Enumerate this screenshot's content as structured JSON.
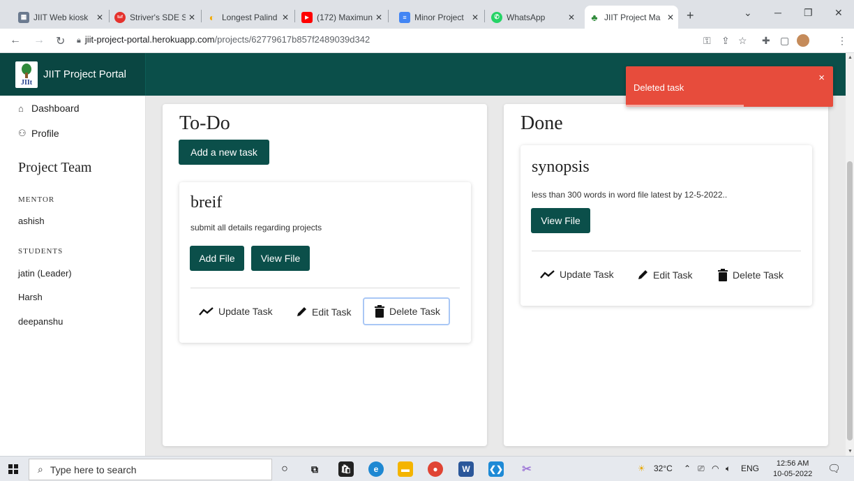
{
  "browser": {
    "tabs": [
      {
        "label": "JIIT Web kiosk",
        "color": "#6b7a8f",
        "glyph": "▦"
      },
      {
        "label": "Striver's SDE Sh",
        "color": "#e5322d",
        "glyph": "tuf"
      },
      {
        "label": "Longest Palind",
        "color": "#f2a900",
        "glyph": "◐"
      },
      {
        "label": "(172) Maximun",
        "color": "#ff0000",
        "glyph": "▶"
      },
      {
        "label": "Minor Project",
        "color": "#4285f4",
        "glyph": "≡"
      },
      {
        "label": "WhatsApp",
        "color": "#25d366",
        "glyph": "✆"
      },
      {
        "label": "JIIT Project Ma",
        "color": "#2f8a3a",
        "glyph": "♣"
      }
    ],
    "new_tab": "+",
    "url_host": "jiit-project-portal.herokuapp.com",
    "url_path": "/projects/62779617b857f2489039d342"
  },
  "app": {
    "brand": "JIIT Project Portal",
    "logo_text": "JIIt",
    "nav": {
      "dashboard": "Dashboard",
      "profile": "Profile"
    },
    "team_heading": "Project Team",
    "mentor_label": "MENTOR",
    "mentor": "ashish",
    "students_label": "STUDENTS",
    "students": [
      "jatin (Leader)",
      "Harsh",
      "deepanshu"
    ],
    "todo": {
      "title": "To-Do",
      "add_button": "Add a new task",
      "task": {
        "title": "breif",
        "description": "submit all details regarding projects",
        "add_file": "Add File",
        "view_file": "View File",
        "update": "Update Task",
        "edit": "Edit Task",
        "delete": "Delete Task"
      }
    },
    "done": {
      "title": "Done",
      "task": {
        "title": "synopsis",
        "description": "less than 300 words in word file latest by 12-5-2022..",
        "view_file": "View File",
        "update": "Update Task",
        "edit": "Edit Task",
        "delete": "Delete Task"
      }
    },
    "toast": {
      "message": "Deleted task",
      "close": "×",
      "progress": 0.57
    },
    "colors": {
      "primary": "#0b4f4a",
      "toast": "#e74c3c"
    }
  },
  "taskbar": {
    "search_placeholder": "Type here to search",
    "weather": "32°C",
    "language": "ENG",
    "time": "12:56 AM",
    "date": "10-05-2022"
  }
}
